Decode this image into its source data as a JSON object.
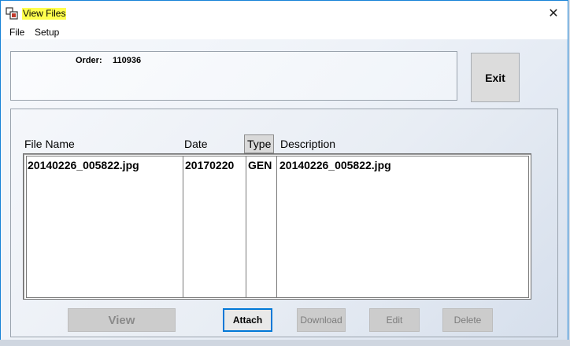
{
  "window": {
    "title": "View Files",
    "close_glyph": "✕"
  },
  "menu": {
    "items": [
      "File",
      "Setup"
    ]
  },
  "order": {
    "label": "Order:",
    "value": "110936"
  },
  "exit_label": "Exit",
  "table": {
    "columns": [
      "File Name",
      "Date",
      "Type",
      "Description"
    ],
    "rows": [
      {
        "file_name": "20140226_005822.jpg",
        "date": "20170220",
        "type": "GEN",
        "description": "20140226_005822.jpg"
      }
    ]
  },
  "buttons": {
    "view": "View",
    "attach": "Attach",
    "download": "Download",
    "edit": "Edit",
    "delete": "Delete"
  },
  "colors": {
    "title_highlight": "#ffff4d",
    "window_border": "#1883d7",
    "focus_border": "#0078d7"
  }
}
